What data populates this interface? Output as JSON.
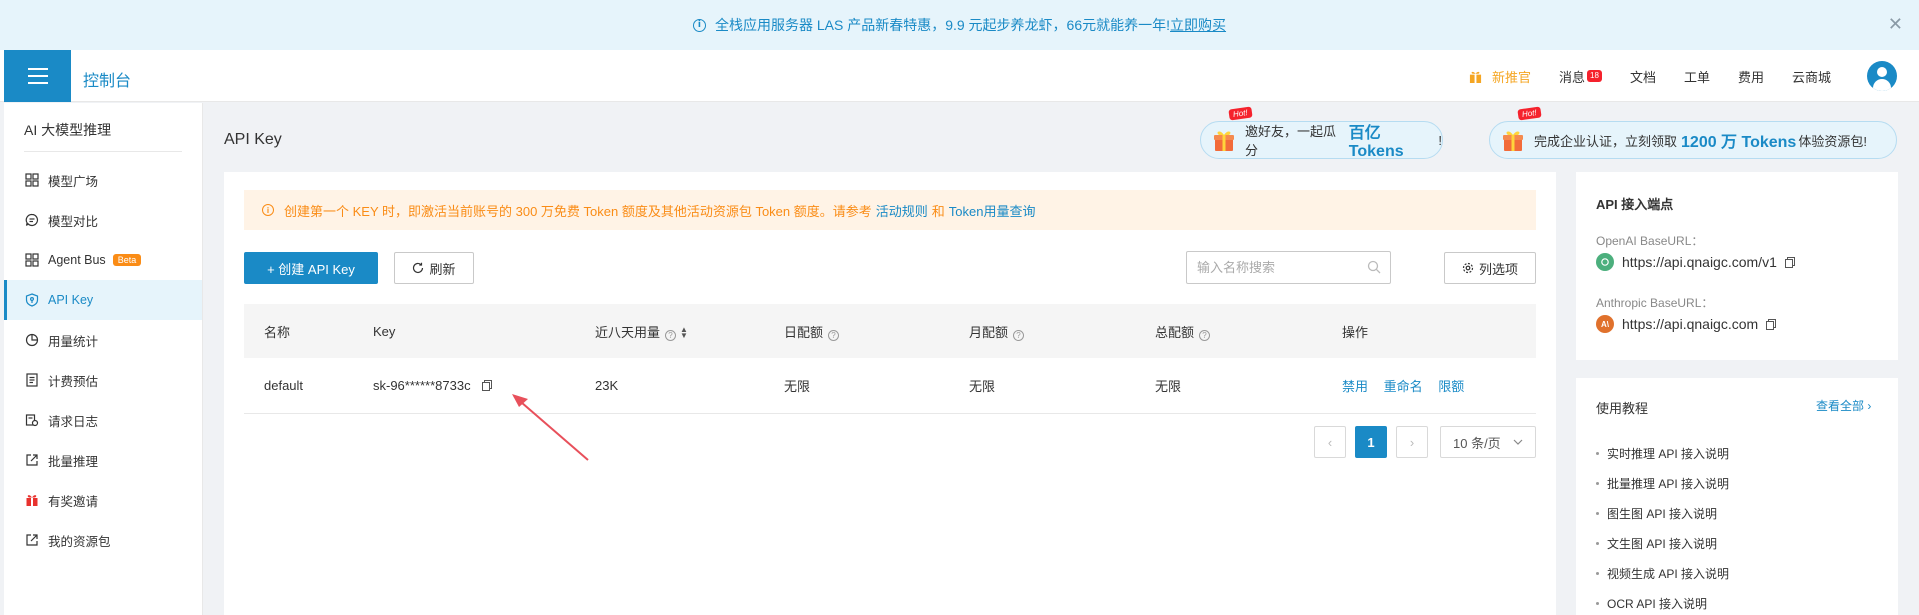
{
  "banner": {
    "text": "全栈应用服务器 LAS 产品新春特惠，9.9 元起步养龙虾，66元就能养一年!",
    "link": "立即购买",
    "info_icon": "info-circle-icon",
    "close_icon": "close-icon"
  },
  "header": {
    "console": "控制台",
    "nav": {
      "newcomer": "新推官",
      "messages": "消息",
      "messages_badge": "18",
      "docs": "文档",
      "tickets": "工单",
      "billing": "费用",
      "cloud_market": "云商城"
    }
  },
  "sidebar": {
    "title": "AI 大模型推理",
    "items": [
      {
        "label": "模型广场",
        "icon": "grid-icon"
      },
      {
        "label": "模型对比",
        "icon": "chat-icon"
      },
      {
        "label": "Agent Bus",
        "icon": "grid-icon",
        "badge": "Beta"
      },
      {
        "label": "API Key",
        "icon": "shield-key-icon",
        "active": true
      },
      {
        "label": "用量统计",
        "icon": "pie-chart-icon"
      },
      {
        "label": "计费预估",
        "icon": "document-icon"
      },
      {
        "label": "请求日志",
        "icon": "log-icon"
      },
      {
        "label": "批量推理",
        "icon": "external-icon"
      },
      {
        "label": "有奖邀请",
        "icon": "gift-icon"
      },
      {
        "label": "我的资源包",
        "icon": "external-icon"
      }
    ]
  },
  "main": {
    "title": "API Key",
    "promos": [
      {
        "hot": "Hot!",
        "pre": "邀好友，一起瓜分",
        "highlight": "百亿 Tokens",
        "post": "!"
      },
      {
        "hot": "Hot!",
        "pre": "完成企业认证，立刻领取",
        "highlight": "1200 万 Tokens",
        "post": "体验资源包!"
      }
    ],
    "notice": {
      "text": "创建第一个 KEY 时，即激活当前账号的 300 万免费 Token 额度及其他活动资源包 Token 额度。请参考",
      "link1": "活动规则",
      "and": "和",
      "link2": "Token用量查询"
    },
    "toolbar": {
      "create": "+ 创建 API Key",
      "refresh": "刷新",
      "search_placeholder": "输入名称搜索",
      "columns": "列选项"
    },
    "table": {
      "headers": [
        "名称",
        "Key",
        "近八天用量",
        "日配额",
        "月配额",
        "总配额",
        "操作"
      ],
      "rows": [
        {
          "name": "default",
          "key": "sk-96******8733c",
          "usage": "23K",
          "daily": "无限",
          "monthly": "无限",
          "total": "无限",
          "ops": [
            "禁用",
            "重命名",
            "限额"
          ]
        }
      ]
    },
    "pagination": {
      "prev": "‹",
      "current": "1",
      "next": "›",
      "page_size": "10 条/页"
    }
  },
  "right_panel": {
    "endpoints": {
      "title": "API 接入端点",
      "openai_label": "OpenAI BaseURL：",
      "openai_url": "https://api.qnaigc.com/v1",
      "anthropic_label": "Anthropic BaseURL：",
      "anthropic_url": "https://api.qnaigc.com"
    },
    "tutorials": {
      "title": "使用教程",
      "view_all": "查看全部",
      "items": [
        "实时推理 API 接入说明",
        "批量推理 API 接入说明",
        "图生图 API 接入说明",
        "文生图 API 接入说明",
        "视频生成 API 接入说明",
        "OCR API 接入说明"
      ]
    }
  },
  "colors": {
    "primary": "#1a8ac6",
    "warning": "#fa8c16",
    "banner_bg": "#e6f4fb",
    "notice_bg": "#fff3e6",
    "annotation_arrow": "#e8505b"
  }
}
